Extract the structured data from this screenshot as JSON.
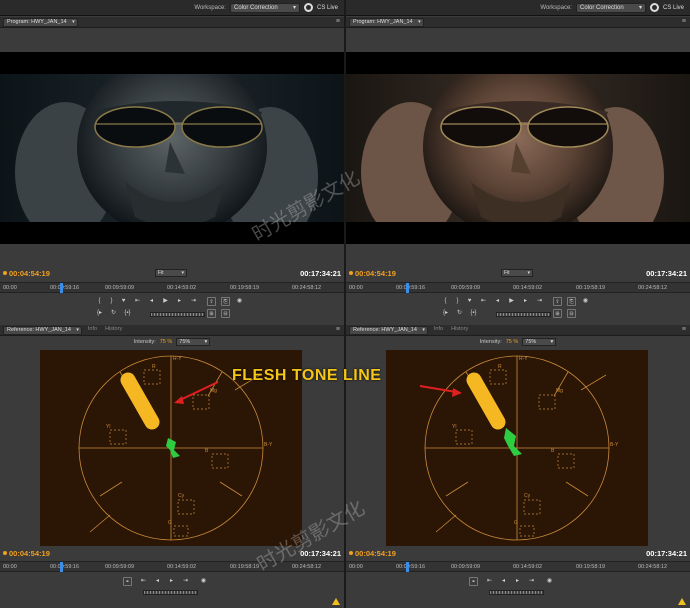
{
  "workspace": {
    "label": "Workspace:",
    "value": "Color Correction",
    "live_label": "CS Live"
  },
  "program_tab": "Program: HWY_JAN_14",
  "reference_tab": "Reference: HWY_JAN_14",
  "info_tab": "Info",
  "history_tab": "History",
  "fit_label": "Fit",
  "timecode_current": "00:04:54:19",
  "timecode_duration": "00:17:34:21",
  "ruler_ticks": [
    "00:00",
    "00:09:59:16",
    "00:09:59:09",
    "00:14:59:02",
    "00:19:58:19",
    "00:24:58:12"
  ],
  "intensity": {
    "label": "Intensity:",
    "value": "75",
    "unit": "%",
    "select": "75%"
  },
  "scope_labels": {
    "r_y": "R-Y",
    "b_y": "B-Y",
    "r": "R",
    "mg": "Mg",
    "yl": "Yl",
    "cy": "Cy",
    "g": "G",
    "b": "B"
  },
  "annotation": "FLESH TONE LINE",
  "watermark": "时光剪影文化",
  "colors": {
    "accent_timecode": "#f0a020",
    "flesh_tone_line": "#f5b822",
    "vectorscope_trace": "#2ecc40",
    "annotation": "#f5c518",
    "arrow": "#e02020"
  }
}
